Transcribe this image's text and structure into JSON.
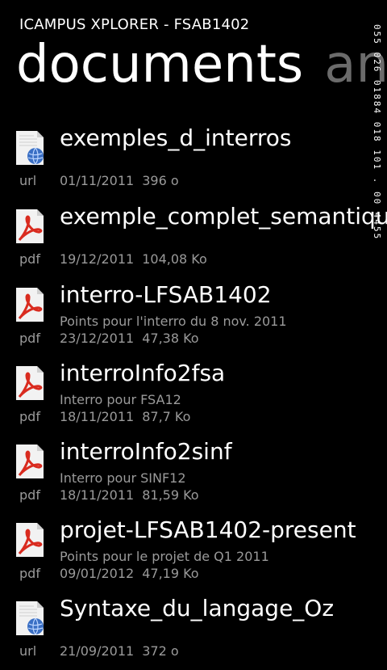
{
  "app": {
    "title": "ICAMPUS XPLORER - FSAB1402"
  },
  "pivot": {
    "active": "documents",
    "next": "an"
  },
  "debug_counter": "055 026 01884 018 101 . 00 4455",
  "items": [
    {
      "name": "exemples_d_interros",
      "description": "",
      "type": "url",
      "date": "01/11/2011",
      "size": "396 o",
      "icon": "web-document-icon"
    },
    {
      "name": "exemple_complet_semantique",
      "description": "",
      "type": "pdf",
      "date": "19/12/2011",
      "size": "104,08 Ko",
      "icon": "pdf-document-icon"
    },
    {
      "name": "interro-LFSAB1402",
      "description": "Points pour l'interro du 8 nov. 2011",
      "type": "pdf",
      "date": "23/12/2011",
      "size": "47,38 Ko",
      "icon": "pdf-document-icon"
    },
    {
      "name": "interroInfo2fsa",
      "description": "Interro pour FSA12",
      "type": "pdf",
      "date": "18/11/2011",
      "size": "87,7 Ko",
      "icon": "pdf-document-icon"
    },
    {
      "name": "interroInfo2sinf",
      "description": "Interro pour SINF12",
      "type": "pdf",
      "date": "18/11/2011",
      "size": "81,59 Ko",
      "icon": "pdf-document-icon"
    },
    {
      "name": "projet-LFSAB1402-present",
      "description": "Points pour le projet de Q1 2011",
      "type": "pdf",
      "date": "09/01/2012",
      "size": "47,19 Ko",
      "icon": "pdf-document-icon"
    },
    {
      "name": "Syntaxe_du_langage_Oz",
      "description": "",
      "type": "url",
      "date": "21/09/2011",
      "size": "372 o",
      "icon": "web-document-icon"
    }
  ]
}
